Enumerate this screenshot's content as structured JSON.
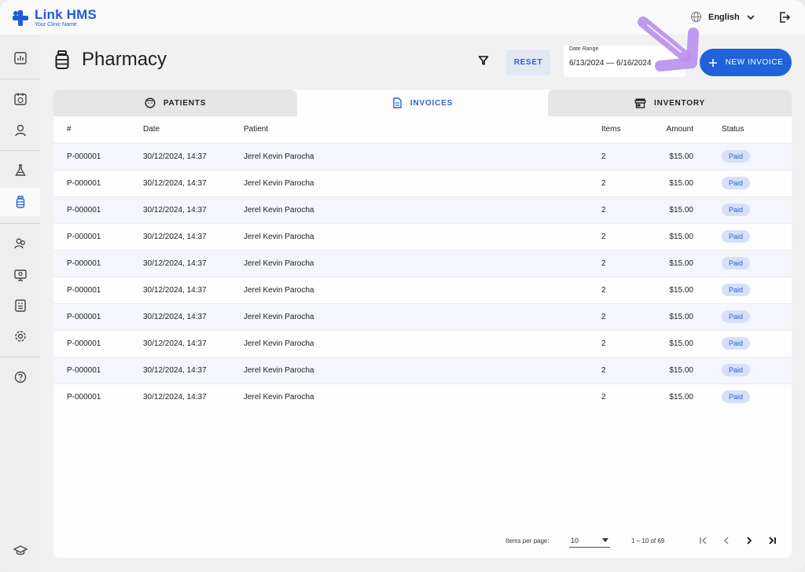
{
  "app": {
    "name": "Link HMS",
    "subtitle": "Your Clinic Name"
  },
  "header": {
    "language": "English"
  },
  "sidebar": {
    "items": [
      {
        "icon": "dashboard-icon"
      },
      {
        "icon": "calendar-icon"
      },
      {
        "icon": "person-icon"
      },
      {
        "icon": "lab-flask-icon"
      },
      {
        "icon": "pharmacy-bottle-icon",
        "active": true
      },
      {
        "icon": "users-icon"
      },
      {
        "icon": "monitor-icon"
      },
      {
        "icon": "report-icon"
      },
      {
        "icon": "settings-gear-icon"
      },
      {
        "icon": "help-icon"
      },
      {
        "icon": "graduation-cap-icon"
      }
    ]
  },
  "page": {
    "title": "Pharmacy",
    "reset_label": "RESET",
    "date_range_label": "Date Range",
    "date_range_value": "6/13/2024 — 6/16/2024",
    "new_invoice_label": "NEW INVOICE"
  },
  "tabs": [
    {
      "label": "PATIENTS",
      "icon": "face-icon"
    },
    {
      "label": "INVOICES",
      "icon": "document-icon",
      "active": true
    },
    {
      "label": "INVENTORY",
      "icon": "store-icon"
    }
  ],
  "table": {
    "columns": [
      "#",
      "Date",
      "Patient",
      "Items",
      "Amount",
      "Status"
    ],
    "rows": [
      {
        "id": "P-000001",
        "date": "30/12/2024, 14:37",
        "patient": "Jerel Kevin Parocha",
        "items": "2",
        "amount": "$15.00",
        "status": "Paid"
      },
      {
        "id": "P-000001",
        "date": "30/12/2024, 14:37",
        "patient": "Jerel Kevin Parocha",
        "items": "2",
        "amount": "$15.00",
        "status": "Paid"
      },
      {
        "id": "P-000001",
        "date": "30/12/2024, 14:37",
        "patient": "Jerel Kevin Parocha",
        "items": "2",
        "amount": "$15.00",
        "status": "Paid"
      },
      {
        "id": "P-000001",
        "date": "30/12/2024, 14:37",
        "patient": "Jerel Kevin Parocha",
        "items": "2",
        "amount": "$15.00",
        "status": "Paid"
      },
      {
        "id": "P-000001",
        "date": "30/12/2024, 14:37",
        "patient": "Jerel Kevin Parocha",
        "items": "2",
        "amount": "$15.00",
        "status": "Paid"
      },
      {
        "id": "P-000001",
        "date": "30/12/2024, 14:37",
        "patient": "Jerel Kevin Parocha",
        "items": "2",
        "amount": "$15.00",
        "status": "Paid"
      },
      {
        "id": "P-000001",
        "date": "30/12/2024, 14:37",
        "patient": "Jerel Kevin Parocha",
        "items": "2",
        "amount": "$15.00",
        "status": "Paid"
      },
      {
        "id": "P-000001",
        "date": "30/12/2024, 14:37",
        "patient": "Jerel Kevin Parocha",
        "items": "2",
        "amount": "$15.00",
        "status": "Paid"
      },
      {
        "id": "P-000001",
        "date": "30/12/2024, 14:37",
        "patient": "Jerel Kevin Parocha",
        "items": "2",
        "amount": "$15.00",
        "status": "Paid"
      },
      {
        "id": "P-000001",
        "date": "30/12/2024, 14:37",
        "patient": "Jerel Kevin Parocha",
        "items": "2",
        "amount": "$15.00",
        "status": "Paid"
      }
    ]
  },
  "pagination": {
    "per_page_label": "Items per page:",
    "per_page_value": "10",
    "range_text": "1 – 10 of 69"
  },
  "colors": {
    "accent": "#1f63db",
    "badge_bg": "#d5e1f7",
    "arrow_annotation": "#b98ef0"
  }
}
